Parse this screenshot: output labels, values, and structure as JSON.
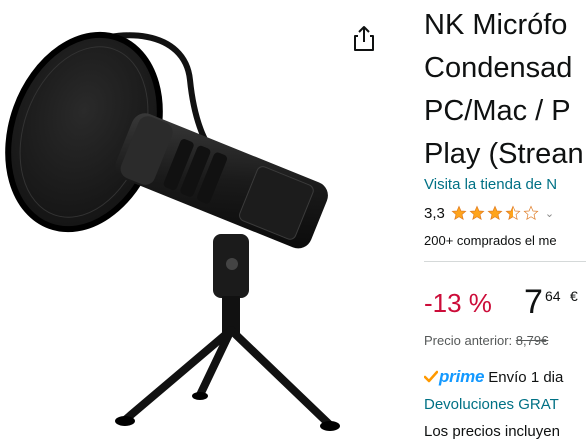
{
  "product": {
    "title_lines": [
      "NK Micrófo",
      "Condensad",
      "PC/Mac / P",
      "Play (Strean"
    ],
    "image_icon": "microphone-tripod-image"
  },
  "store": {
    "link_text": "Visita la tienda de N"
  },
  "rating": {
    "value": "3,3",
    "stars": 3.5,
    "chevron": "⌄"
  },
  "social_proof": {
    "bought_text": "200+ comprados el me"
  },
  "pricing": {
    "discount": "-13 %",
    "price_whole": "7",
    "price_fraction": "64",
    "currency": "€",
    "previous_label": "Precio anterior:",
    "previous_value": "8,79€"
  },
  "delivery": {
    "prime_label": "prime",
    "text": "Envío 1 dia"
  },
  "returns": {
    "text": "Devoluciones GRAT"
  },
  "taxes": {
    "text": "Los precios incluyen"
  },
  "colors": {
    "link": "#007185",
    "discount": "#cc0c39",
    "star": "#ffa41c",
    "prime": "#1399ff",
    "prime_check": "#ff9900"
  },
  "icons": {
    "share": "share-icon",
    "star": "star-icon"
  }
}
